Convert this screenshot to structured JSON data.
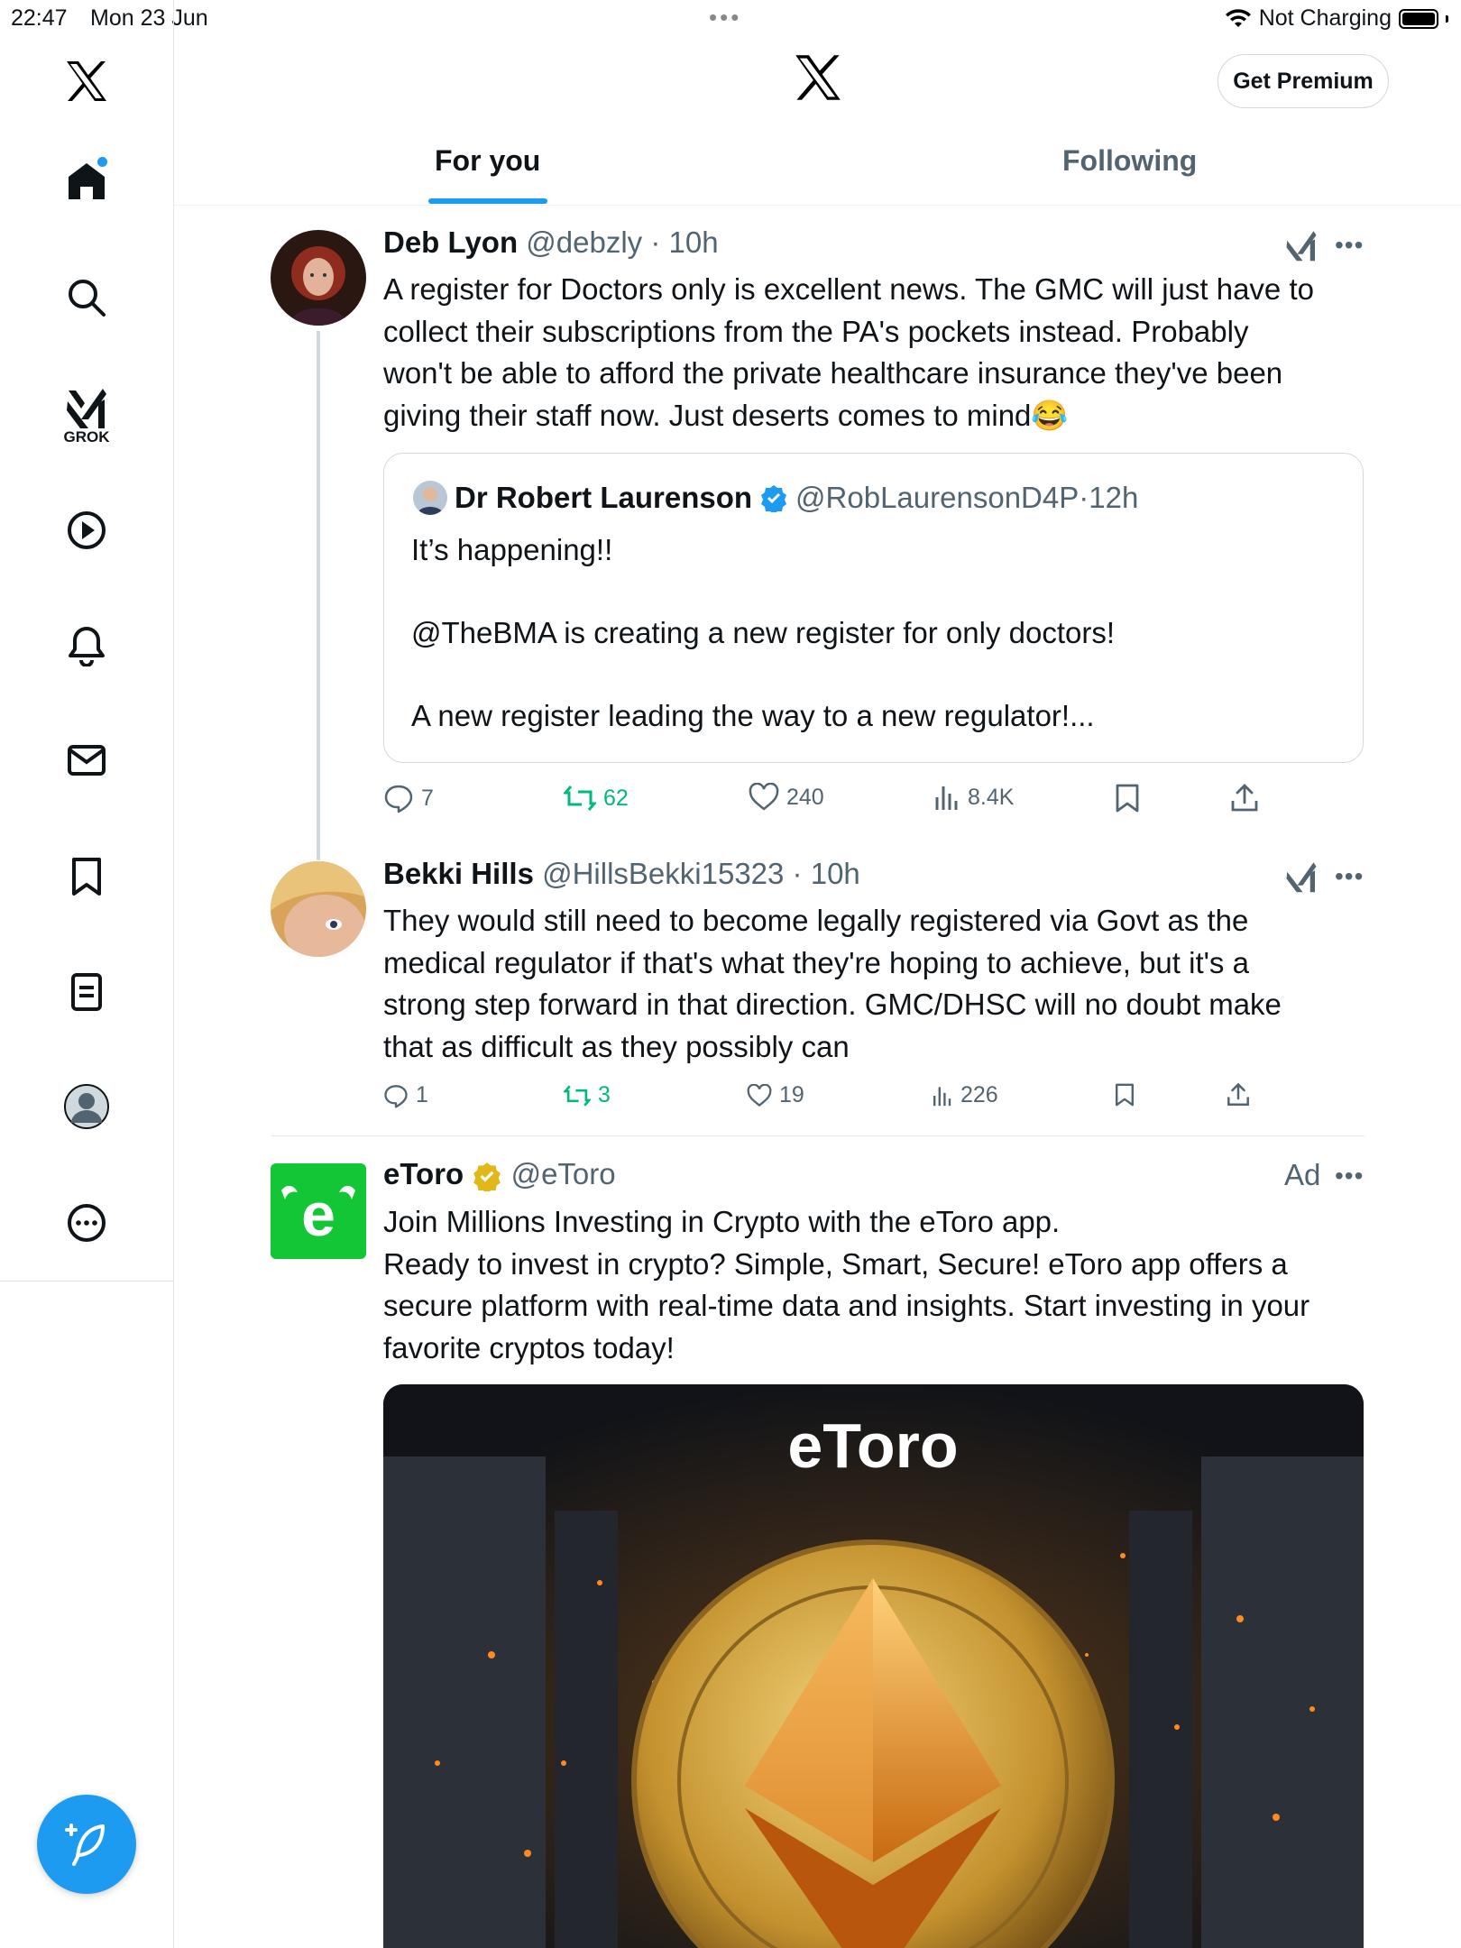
{
  "status_bar": {
    "time": "22:47",
    "date": "Mon 23 Jun",
    "dots": "•••",
    "charging": "Not Charging"
  },
  "header": {
    "premium_label": "Get Premium"
  },
  "tabs": [
    {
      "label": "For you",
      "active": true
    },
    {
      "label": "Following",
      "active": false
    }
  ],
  "sidebar": {
    "items": [
      "home-icon",
      "search-icon",
      "grok-icon",
      "video-icon",
      "notifications-icon",
      "messages-icon",
      "bookmarks-icon",
      "lists-icon",
      "profile-icon",
      "more-icon"
    ],
    "grok_label": "GROK"
  },
  "tweets": [
    {
      "name": "Deb Lyon",
      "handle": "@debzly",
      "time": "10h",
      "text_lines": [
        "A register for Doctors only is excellent news. The GMC will just have to",
        "collect their subscriptions from the PA's pockets instead. Probably",
        "won't be able to afford the private healthcare insurance they've been",
        "giving their staff now. Just deserts comes to mind😂"
      ],
      "quote": {
        "name": "Dr Robert Laurenson",
        "handle": "@RobLaurensonD4P",
        "time": "12h",
        "paragraphs": [
          "It’s happening!!",
          "@TheBMA is creating a new register for only doctors!",
          "A new register leading the way to a new regulator!..."
        ]
      },
      "stats": {
        "replies": "7",
        "reposts": "62",
        "likes": "240",
        "views": "8.4K"
      }
    },
    {
      "name": "Bekki Hills",
      "handle": "@HillsBekki15323",
      "time": "10h",
      "text_lines": [
        "They would still need to become legally registered via Govt as the",
        "medical regulator if that's what they're hoping to achieve, but it's a",
        "strong step forward in that direction. GMC/DHSC will no doubt make",
        "that as difficult as they possibly can"
      ],
      "stats": {
        "replies": "1",
        "reposts": "3",
        "likes": "19",
        "views": "226"
      }
    },
    {
      "name": "eToro",
      "handle": "@eToro",
      "ad_label": "Ad",
      "text_lines": [
        "Join Millions Investing in Crypto with the eToro app.",
        "Ready to invest in crypto? Simple, Smart, Secure! eToro app offers a",
        "secure platform with real-time data and insights. Start investing in your",
        "favorite cryptos today!"
      ],
      "image_brand": "eToro"
    }
  ],
  "colors": {
    "accent": "#1d9bf0",
    "repost": "#00ba7c",
    "secondary": "#536471",
    "etoro_green": "#13c636"
  }
}
